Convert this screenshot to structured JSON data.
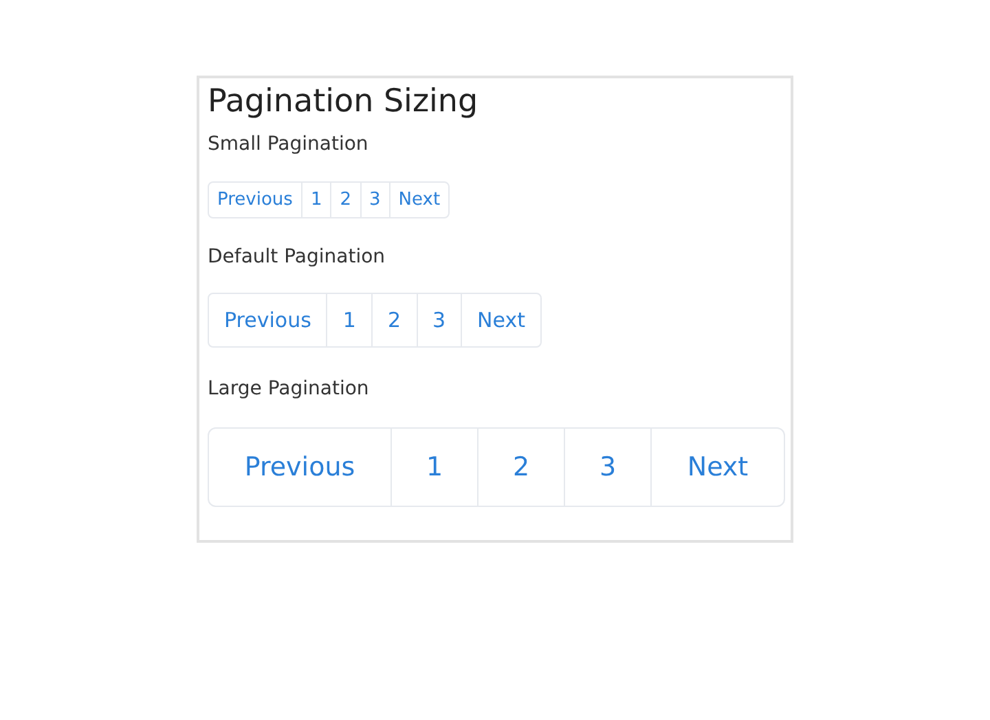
{
  "title": "Pagination Sizing",
  "sections": [
    {
      "label": "Small Pagination",
      "kind": "small",
      "items": [
        "Previous",
        "1",
        "2",
        "3",
        "Next"
      ]
    },
    {
      "label": "Default Pagination",
      "kind": "default",
      "items": [
        "Previous",
        "1",
        "2",
        "3",
        "Next"
      ]
    },
    {
      "label": "Large Pagination",
      "kind": "large",
      "items": [
        "Previous",
        "1",
        "2",
        "3",
        "Next"
      ]
    }
  ]
}
